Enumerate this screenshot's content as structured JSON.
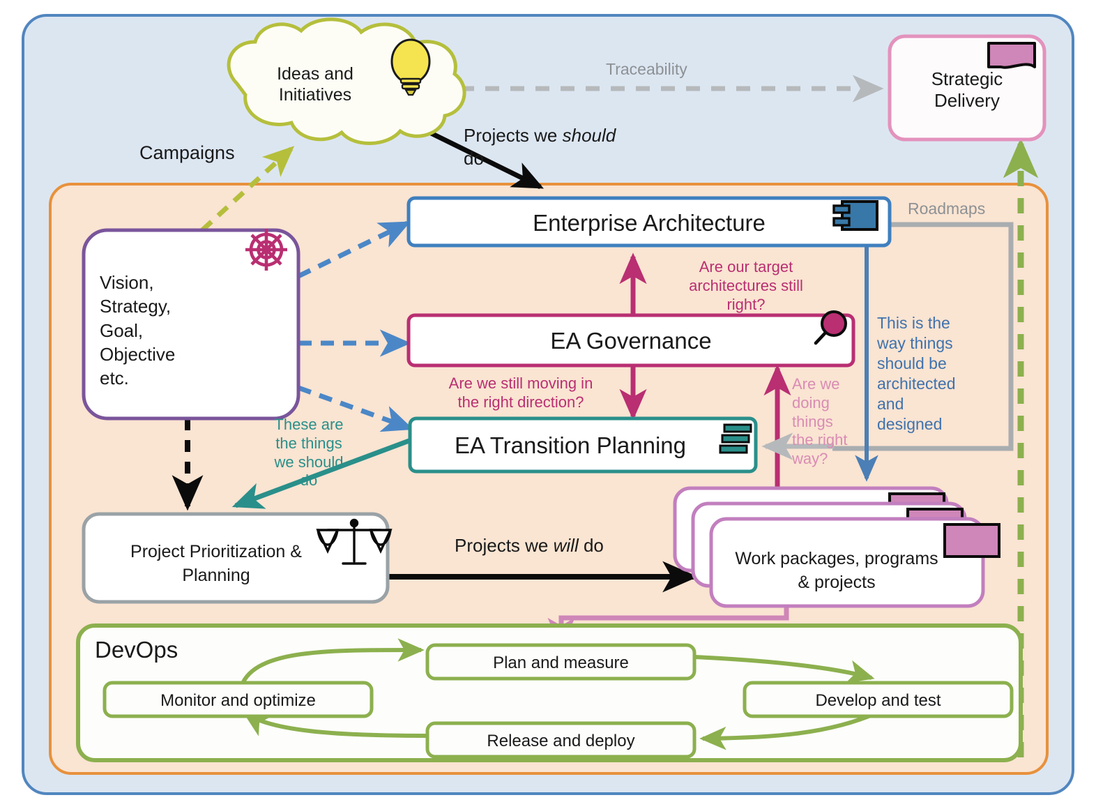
{
  "diagram": {
    "title_hidden": "",
    "outer_zone": {
      "name": "strategy-zone",
      "fill": "#dce6f1",
      "border": "#5186bf"
    },
    "inner_zone": {
      "name": "architecture-zone",
      "fill": "#fae4d2",
      "border": "#e8913c"
    }
  },
  "nodes": {
    "ideas_cloud": {
      "label_line1": "Ideas and",
      "label_line2": "Initiatives",
      "icon": "lightbulb-icon",
      "border": "#b5bf3c",
      "fill": "#fdfdf6"
    },
    "strategic_delivery": {
      "label_line1": "Strategic",
      "label_line2": "Delivery",
      "icon": "deliverable-icon",
      "border": "#e392bd",
      "fill": "#fdfbfc"
    },
    "vision": {
      "lines": [
        "Vision,",
        "Strategy,",
        "Goal,",
        "Objective",
        "etc."
      ],
      "icon": "ships-wheel-icon",
      "border": "#7a559b",
      "fill": "#ffffff"
    },
    "enterprise_architecture": {
      "label": "Enterprise Architecture",
      "icon": "component-icon",
      "border": "#3f7fbe",
      "fill": "#ffffff"
    },
    "ea_governance": {
      "label": "EA Governance",
      "icon": "magnifier-icon",
      "border": "#b92f72",
      "fill": "#ffffff"
    },
    "ea_transition_planning": {
      "label": "EA Transition Planning",
      "icon": "plateau-icon",
      "border": "#2a8f8a",
      "fill": "#ffffff"
    },
    "project_prioritization": {
      "label_line1": "Project Prioritization &",
      "label_line2": "Planning",
      "icon": "balance-scales-icon",
      "border": "#9aa2a6",
      "fill": "#ffffff"
    },
    "work_packages": {
      "label_line1": "Work packages, programs",
      "label_line2": "& projects",
      "icon": "work-package-icon",
      "border": "#c27fbe",
      "fill": "#ffffff",
      "stack_count": 3
    },
    "roadmaps_group": {
      "label": "Roadmaps",
      "border": "#a9adb0"
    },
    "devops_group": {
      "label": "DevOps",
      "border": "#8cb04e",
      "fill": "#fdfdfb"
    },
    "devops_steps": [
      {
        "label": "Plan and measure"
      },
      {
        "label": "Develop and test"
      },
      {
        "label": "Release and deploy"
      },
      {
        "label": "Monitor and optimize"
      }
    ]
  },
  "edge_labels": {
    "campaigns": "Campaigns",
    "traceability": "Traceability",
    "projects_should_do_a": "Projects we ",
    "projects_should_do_em": "should",
    "projects_should_do_b": "do",
    "projects_will_do_a": "Projects we ",
    "projects_will_do_em": "will",
    "projects_will_do_b": " do",
    "target_arch_right": "Are our target\narchitectures still\nright?",
    "moving_right_direction": "Are we still moving in\nthe right direction?",
    "doing_things_right_way": "Are we\ndoing\nthings\nthe right\nway?",
    "way_things_designed": "This is the\nway things\nshould be\narchitected\nand\ndesigned",
    "these_are_things": "These are\nthe things\nwe should\ndo"
  },
  "colors": {
    "black": "#0b0b0b",
    "grey": "#b6b9bb",
    "grey_text": "#8d9194",
    "blue_dash": "#4b87c7",
    "blue_solid": "#4b7fb5",
    "magenta": "#b92f72",
    "magenta_faded": "#d98cb4",
    "teal": "#2a8f8a",
    "olive": "#b5bf3c",
    "green": "#8cb04e",
    "pink": "#cf86b8",
    "purple": "#7a559b"
  }
}
